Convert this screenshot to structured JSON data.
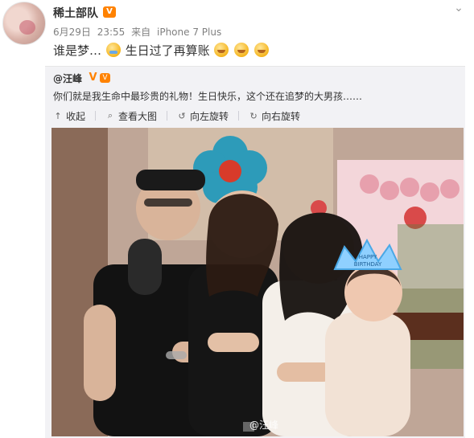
{
  "post": {
    "author": "稀土部队",
    "vip_badge": "V",
    "date": "6月29日",
    "time": "23:55",
    "source_prefix": "来自",
    "source_device": "iPhone 7 Plus",
    "text_before": "谁是梦…",
    "text_after": "生日过了再算账",
    "emoji_after_count": 3
  },
  "icons": {
    "chevron": "chevron-down-icon",
    "emoji_cry": "laugh-cry-emoji-icon",
    "emoji_grin": "grin-emoji-icon",
    "collapse": "collapse-icon",
    "view_large": "magnify-icon",
    "rotate_left": "rotate-left-icon",
    "rotate_right": "rotate-right-icon"
  },
  "repost": {
    "author": "@汪峰",
    "verified": "V",
    "text": "你们就是我生命中最珍贵的礼物！生日快乐，这个还在追梦的大男孩……",
    "actions": {
      "collapse": "收起",
      "view_large": "查看大图",
      "rotate_left": "向左旋转",
      "rotate_right": "向右旋转"
    },
    "photo": {
      "watermark": "@汪峰",
      "crown_text_line1": "HAPPY",
      "crown_text_line2": "BIRTHDAY"
    }
  },
  "colors": {
    "accent": "#ff8200",
    "repost_bg": "#f2f2f5",
    "meta_text": "#808080"
  }
}
